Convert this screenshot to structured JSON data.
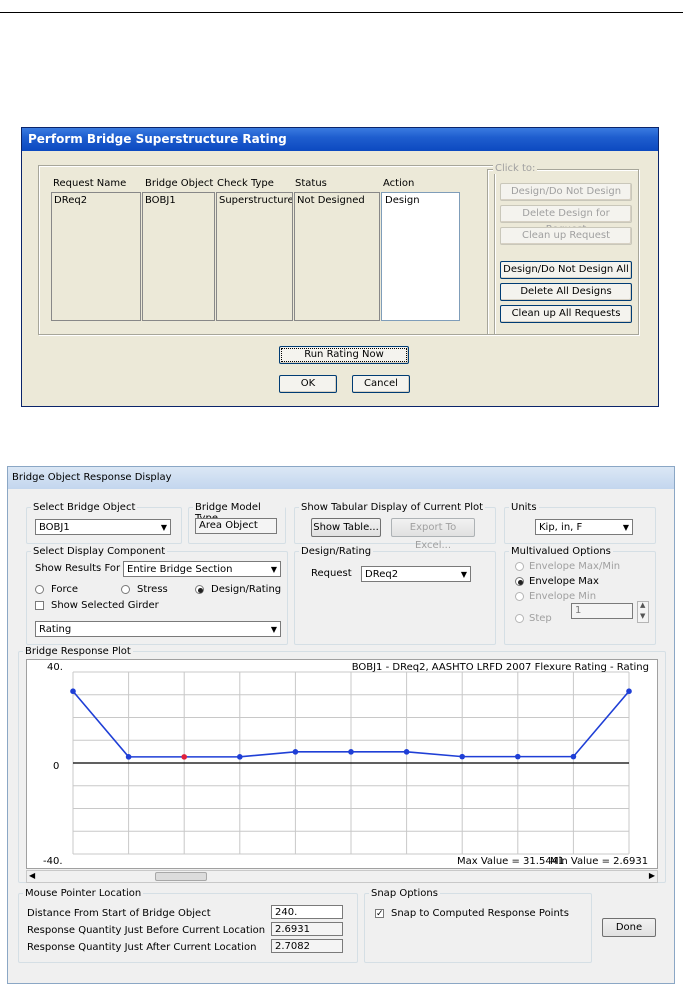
{
  "dialog1": {
    "title": "Perform Bridge Superstructure Rating",
    "columns": [
      "Request Name",
      "Bridge Object",
      "Check Type",
      "Status",
      "Action"
    ],
    "row": [
      "DReq2",
      "BOBJ1",
      "Superstructure R",
      "Not Designed",
      "Design"
    ],
    "click_to_label": "Click to:",
    "buttons": {
      "design_toggle": "Design/Do Not Design",
      "delete_design": "Delete Design for Request",
      "clean_up_request": "Clean up Request",
      "design_toggle_all": "Design/Do Not Design All",
      "delete_all": "Delete All Designs",
      "clean_up_all": "Clean up All Requests",
      "run": "Run Rating Now",
      "ok": "OK",
      "cancel": "Cancel"
    }
  },
  "dialog2": {
    "title": "Bridge Object Response Display",
    "select_bridge_object": {
      "legend": "Select Bridge Object",
      "value": "BOBJ1"
    },
    "bridge_model_type": {
      "legend": "Bridge Model Type",
      "value": "Area Object"
    },
    "tabular": {
      "legend": "Show Tabular Display of Current Plot",
      "show_table": "Show Table...",
      "export": "Export To Excel..."
    },
    "units": {
      "legend": "Units",
      "value": "Kip, in, F"
    },
    "display_component": {
      "legend": "Select Display Component",
      "show_results_for_label": "Show Results For",
      "show_results_for_value": "Entire Bridge Section",
      "radios": [
        "Force",
        "Stress",
        "Design/Rating"
      ],
      "selected_radio": "Design/Rating",
      "show_selected_girder": "Show Selected Girder",
      "component_value": "Rating"
    },
    "design_rating": {
      "legend": "Design/Rating",
      "request_label": "Request",
      "request_value": "DReq2"
    },
    "multivalued": {
      "legend": "Multivalued Options",
      "options": [
        "Envelope Max/Min",
        "Envelope Max",
        "Envelope Min",
        "Step"
      ],
      "selected": "Envelope Max",
      "step_value": "1"
    },
    "plot": {
      "legend": "Bridge Response Plot",
      "caption": "BOBJ1 - DReq2, AASHTO LRFD 2007 Flexure Rating - Rating",
      "y_top": "40.",
      "y_mid": "0",
      "y_bottom": "-40.",
      "max_text": "Max Value = 31.5441",
      "min_text": "Min Value = 2.6931"
    },
    "mouse_pointer": {
      "legend": "Mouse Pointer Location",
      "distance_label": "Distance From Start of Bridge Object",
      "distance_value": "240.",
      "before_label": "Response Quantity Just Before Current Location",
      "before_value": "2.6931",
      "after_label": "Response Quantity Just After Current Location",
      "after_value": "2.7082"
    },
    "snap": {
      "legend": "Snap Options",
      "label": "Snap to Computed Response Points",
      "checked": true
    },
    "done": "Done"
  },
  "chart_data": {
    "type": "line",
    "title": "BOBJ1 - DReq2, AASHTO LRFD 2007 Flexure Rating - Rating",
    "ylim": [
      -40,
      40
    ],
    "x": [
      0,
      1,
      2,
      3,
      4,
      5,
      6,
      7,
      8,
      9,
      10
    ],
    "values": [
      31.5441,
      2.7,
      2.6931,
      2.7082,
      4.9,
      4.9,
      4.9,
      2.8,
      2.8,
      2.8,
      31.5441
    ],
    "highlight_index": 2,
    "grid": true,
    "line_color": "#1f3fd6",
    "point_color": "#1f3fd6",
    "highlight_color": "#e0203c"
  }
}
